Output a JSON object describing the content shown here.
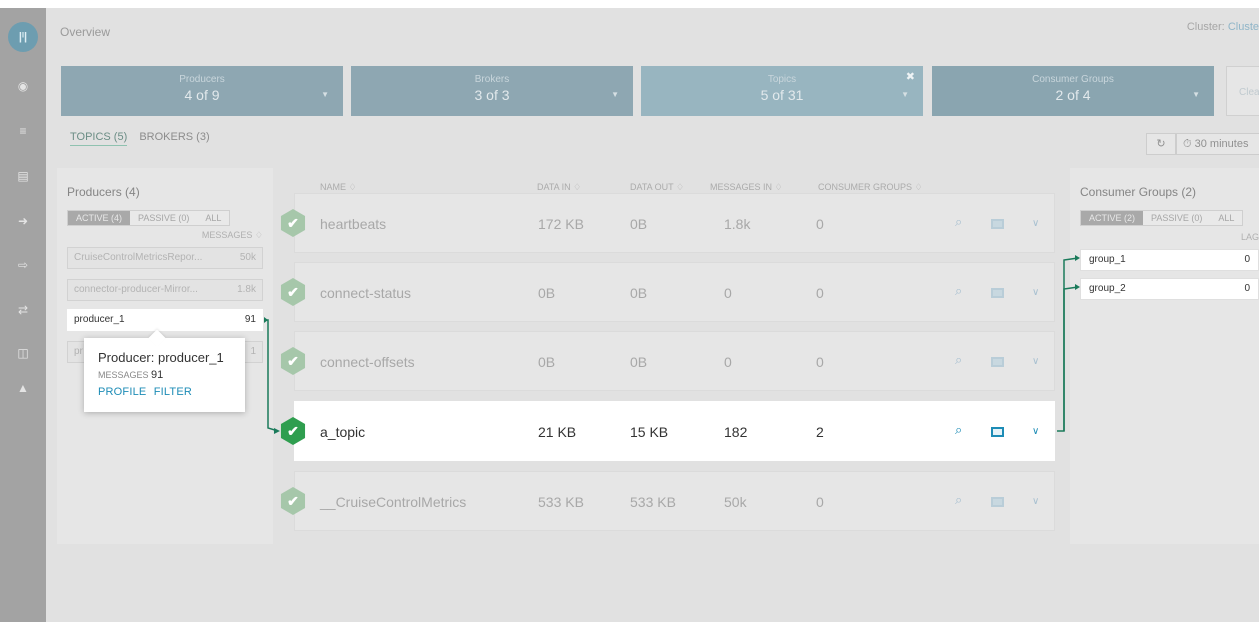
{
  "nav": {
    "logo_text": "|ᴵ|",
    "icons": [
      "dashboard-icon",
      "topics-icon",
      "brokers-icon",
      "producers-icon",
      "consumers-icon",
      "replication-icon",
      "schema-icon",
      "alerts-icon"
    ]
  },
  "header": {
    "breadcrumb": "Overview",
    "cluster_label": "Cluster:",
    "cluster_value": "Cluste"
  },
  "filters": [
    {
      "label": "Producers",
      "value": "4 of 9"
    },
    {
      "label": "Brokers",
      "value": "3 of 3"
    },
    {
      "label": "Topics",
      "value": "5 of 31",
      "clear_glyph": "✖"
    },
    {
      "label": "Consumer Groups",
      "value": "2 of 4"
    }
  ],
  "clear_all": "Clea",
  "tabs": [
    "TOPICS (5)",
    "BROKERS (3)"
  ],
  "time_range": "⏱ 30 minutes",
  "refresh_glyph": "↻",
  "producers": {
    "title": "Producers (4)",
    "segments": [
      "ACTIVE (4)",
      "PASSIVE (0)",
      "ALL"
    ],
    "column": "MESSAGES ♢",
    "rows": [
      {
        "name": "CruiseControlMetricsRepor...",
        "count": "50k"
      },
      {
        "name": "connector-producer-Mirror...",
        "count": "1.8k"
      },
      {
        "name": "producer_1",
        "count": "91"
      },
      {
        "name": "pr",
        "count": "1"
      }
    ]
  },
  "tooltip": {
    "title": "Producer: producer_1",
    "messages_label": "MESSAGES",
    "messages_value": "91",
    "link_profile": "PROFILE",
    "link_filter": "FILTER"
  },
  "table": {
    "headers": [
      "NAME ♢",
      "DATA IN ♢",
      "DATA OUT ♢",
      "MESSAGES IN ♢",
      "CONSUMER GROUPS ♢"
    ],
    "rows": [
      {
        "name": "heartbeats",
        "data_in": "172 KB",
        "data_out": "0B",
        "messages_in": "1.8k",
        "consumer_groups": "0"
      },
      {
        "name": "connect-status",
        "data_in": "0B",
        "data_out": "0B",
        "messages_in": "0",
        "consumer_groups": "0"
      },
      {
        "name": "connect-offsets",
        "data_in": "0B",
        "data_out": "0B",
        "messages_in": "0",
        "consumer_groups": "0"
      },
      {
        "name": "a_topic",
        "data_in": "21 KB",
        "data_out": "15 KB",
        "messages_in": "182",
        "consumer_groups": "2"
      },
      {
        "name": "__CruiseControlMetrics",
        "data_in": "533 KB",
        "data_out": "533 KB",
        "messages_in": "50k",
        "consumer_groups": "0"
      }
    ],
    "check_glyph": "✔",
    "search_glyph": "⌕",
    "chevron_glyph": "∨"
  },
  "consumers": {
    "title": "Consumer Groups (2)",
    "segments": [
      "ACTIVE (2)",
      "PASSIVE (0)",
      "ALL"
    ],
    "column": "LAG",
    "rows": [
      {
        "name": "group_1",
        "lag": "0"
      },
      {
        "name": "group_2",
        "lag": "0"
      }
    ]
  },
  "colors": {
    "accent": "#1d8cb6",
    "healthy": "#2f9e4f",
    "link": "#1a7a5a"
  }
}
